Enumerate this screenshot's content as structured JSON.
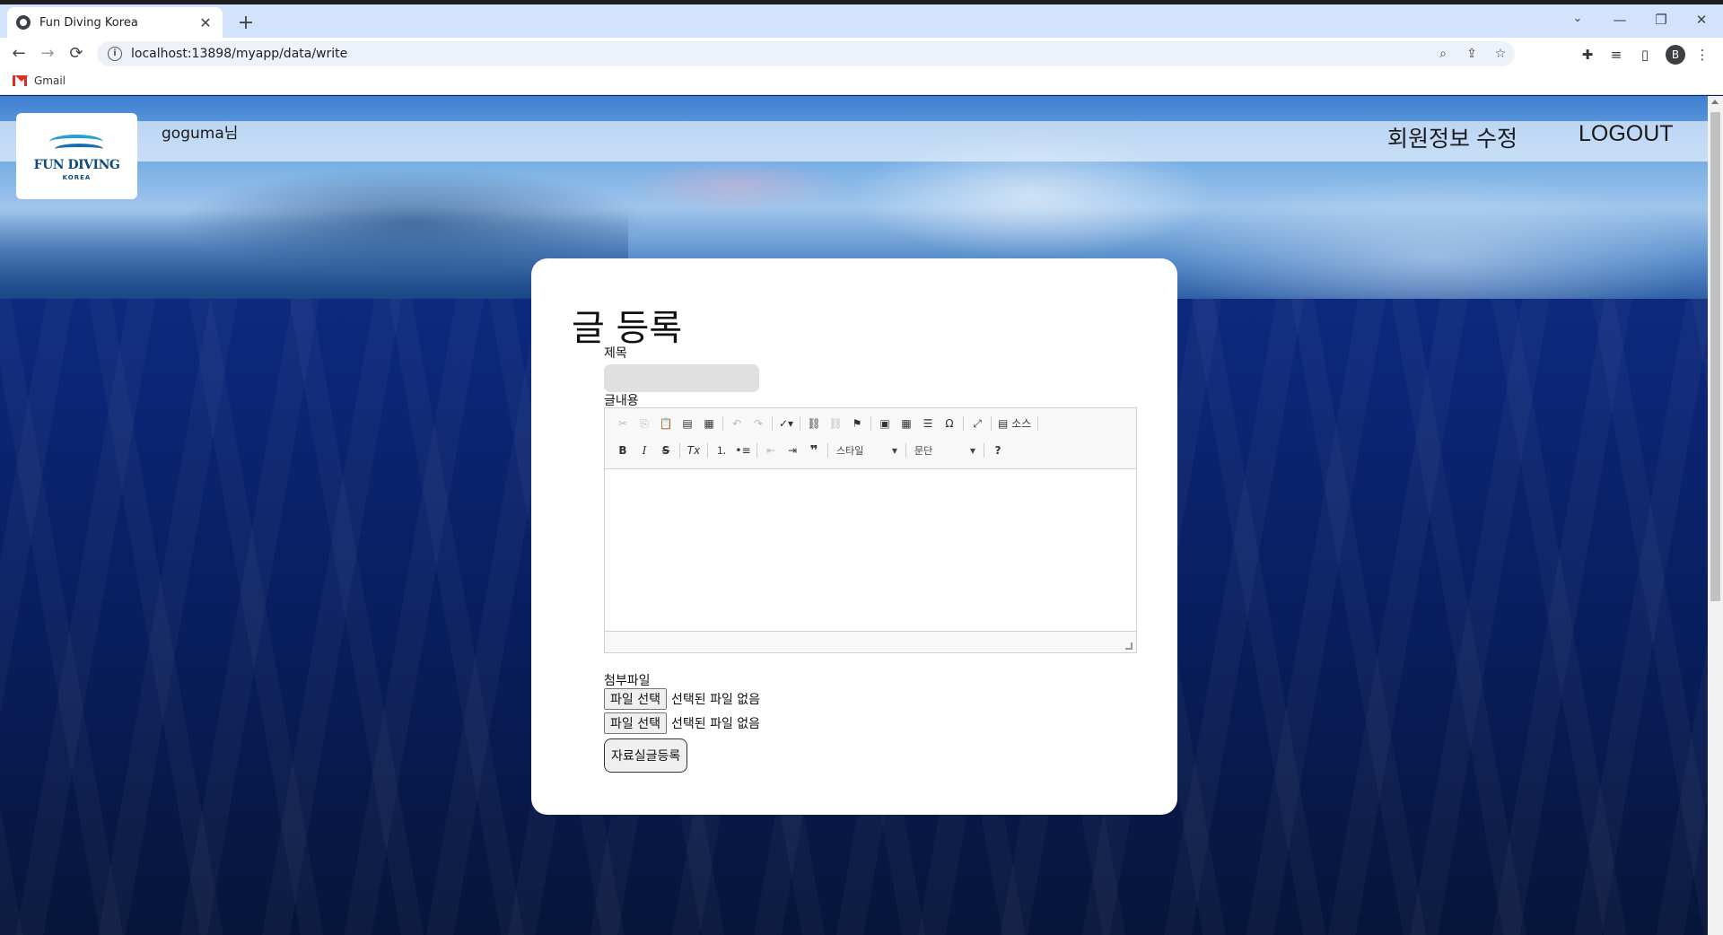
{
  "browser": {
    "tab_title": "Fun Diving Korea",
    "tab_close": "✕",
    "new_tab": "+",
    "url": "localhost:13898/myapp/data/write",
    "bookmark_gmail": "Gmail",
    "profile_initial": "B",
    "back": "←",
    "forward": "→",
    "reload": "⟳",
    "minimize": "—",
    "restore": "❐",
    "close": "✕",
    "tab_search": "⌄"
  },
  "site": {
    "logo_text": "FUN DIVING",
    "logo_sub": "KOREA",
    "username": "goguma님",
    "nav": {
      "edit_profile": "회원정보 수정",
      "logout": "LOGOUT"
    }
  },
  "form": {
    "heading": "글 등록",
    "title_label": "제목",
    "title_value": "",
    "content_label": "글내용",
    "attachment_label": "첨부파일",
    "file_inputs": [
      {
        "button": "파일 선택",
        "status": "선택된 파일 없음"
      },
      {
        "button": "파일 선택",
        "status": "선택된 파일 없음"
      }
    ],
    "submit": "자료실글등록"
  },
  "editor": {
    "source_label": "소스",
    "style_combo": "스타일",
    "format_combo": "문단",
    "help": "?"
  },
  "colors": {
    "ocean": "#0c2576",
    "card": "#ffffff",
    "tab_strip": "#d3e3fd"
  }
}
